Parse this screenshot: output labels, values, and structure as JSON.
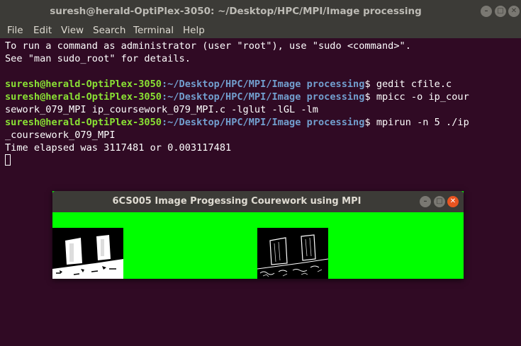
{
  "window": {
    "title": "suresh@herald-OptiPlex-3050: ~/Desktop/HPC/MPI/Image processing"
  },
  "menu": [
    "File",
    "Edit",
    "View",
    "Search",
    "Terminal",
    "Help"
  ],
  "terminal": {
    "intro1": "To run a command as administrator (user \"root\"), use \"sudo <command>\".",
    "intro2": "See \"man sudo_root\" for details.",
    "prompt_user": "suresh@herald-OptiPlex-3050",
    "prompt_path": ":~/Desktop/HPC/MPI/Image processing",
    "prompt_symbol": "$ ",
    "cmd1": "gedit cfile.c",
    "cmd2a": "mpicc -o ip_cour",
    "cmd2b": "sework_079_MPI ip_coursework_079_MPI.c -lglut -lGL -lm",
    "cmd3a": "mpirun -n 5 ./ip",
    "cmd3b": "_coursework_079_MPI",
    "output": "Time elapsed was 3117481 or 0.003117481"
  },
  "gl_window": {
    "title": "6CS005 Image Progessing Courework using MPI",
    "background_color": "#00ff00"
  },
  "colors": {
    "terminal_bg": "#300a24",
    "prompt_user": "#8ae234",
    "prompt_path": "#729fcf",
    "titlebar": "#3c3b37",
    "close_button": "#e95420"
  }
}
